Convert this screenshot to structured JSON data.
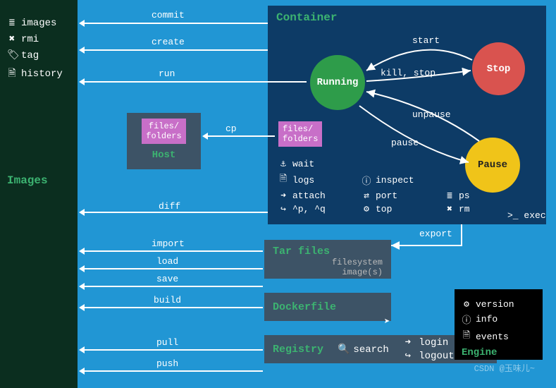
{
  "sidebar": {
    "items": [
      {
        "icon": "≣",
        "label": "images"
      },
      {
        "icon": "✖",
        "label": "rmi"
      },
      {
        "icon": "🏷",
        "label": "tag"
      },
      {
        "icon": "🗎",
        "label": "history"
      }
    ],
    "title": "Images"
  },
  "container": {
    "title": "Container",
    "states": {
      "running": "Running",
      "stop": "Stop",
      "pause": "Pause"
    },
    "transitions": {
      "start": "start",
      "kill_stop": "kill, stop",
      "unpause": "unpause",
      "pause": "pause"
    },
    "commands": [
      {
        "icon": "⚓",
        "label": "wait"
      },
      {
        "icon": "",
        "label": ""
      },
      {
        "icon": "",
        "label": ""
      },
      {
        "icon": "🗎",
        "label": "logs"
      },
      {
        "icon": "ⓘ",
        "label": "inspect"
      },
      {
        "icon": "",
        "label": ""
      },
      {
        "icon": "➜",
        "label": "attach"
      },
      {
        "icon": "⇄",
        "label": "port"
      },
      {
        "icon": "≣",
        "label": "ps"
      },
      {
        "icon": "↪",
        "label": "^p, ^q"
      },
      {
        "icon": "⚙",
        "label": "top"
      },
      {
        "icon": "✖",
        "label": "rm"
      }
    ],
    "exec": {
      "icon": ">_",
      "label": "exec"
    }
  },
  "host": {
    "ff": "files/\nfolders",
    "label": "Host",
    "cp": "cp"
  },
  "container_ff": "files/\nfolders",
  "arrows": {
    "commit": "commit",
    "create": "create",
    "run": "run",
    "diff": "diff",
    "import": "import",
    "load": "load",
    "save": "save",
    "build": "build",
    "pull": "pull",
    "push": "push",
    "export": "export"
  },
  "tarfiles": {
    "title": "Tar files",
    "sub1": "filesystem",
    "sub2": "image(s)"
  },
  "dockerfile": {
    "title": "Dockerfile"
  },
  "registry": {
    "title": "Registry",
    "search": {
      "icon": "🔍",
      "label": "search"
    },
    "login": {
      "icon": "➜",
      "label": "login"
    },
    "logout": {
      "icon": "↪",
      "label": "logout"
    }
  },
  "engine": {
    "items": [
      {
        "icon": "⚙",
        "label": "version"
      },
      {
        "icon": "ⓘ",
        "label": "info"
      },
      {
        "icon": "🗎",
        "label": "events"
      }
    ],
    "title": "Engine"
  },
  "watermark": "CSDN @玉味儿~"
}
